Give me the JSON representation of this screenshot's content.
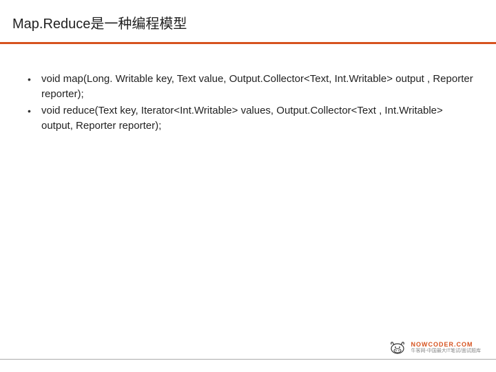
{
  "slide": {
    "title": "Map.Reduce是一种编程模型",
    "bullets": [
      "void map(Long. Writable key, Text value, Output.Collector<Text, Int.Writable> output , Reporter reporter);",
      "void reduce(Text key, Iterator<Int.Writable> values, Output.Collector<Text , Int.Writable> output, Reporter reporter);"
    ]
  },
  "footer": {
    "logo_main": "NOWCODER.COM",
    "logo_sub": "牛客网-中国最大IT笔试/面试题库"
  },
  "colors": {
    "accent": "#d6521e",
    "text": "#222222"
  }
}
